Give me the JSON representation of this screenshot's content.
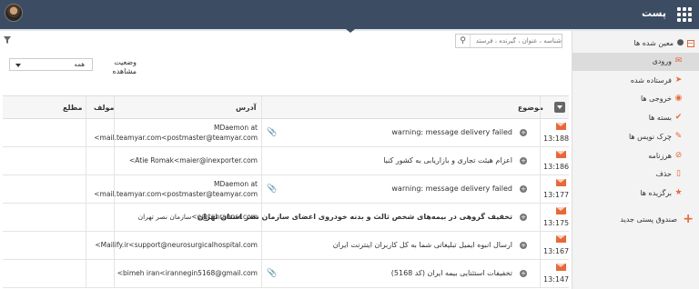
{
  "header": {
    "app_title": "پست"
  },
  "sidebar": {
    "root_label": "معین شده ها",
    "items": [
      {
        "label": "ورودی",
        "icon": "inbox-icon",
        "active": true
      },
      {
        "label": "فرستاده شده",
        "icon": "sent-icon"
      },
      {
        "label": "خروجی ها",
        "icon": "outbox-icon"
      },
      {
        "label": "بسته ها",
        "icon": "check-icon"
      },
      {
        "label": "چرک نویس ها",
        "icon": "draft-icon"
      },
      {
        "label": "هرزنامه",
        "icon": "spam-icon"
      },
      {
        "label": "حذف",
        "icon": "trash-icon"
      },
      {
        "label": "برگزیده ها",
        "icon": "favorites-icon"
      }
    ],
    "new_folder_label": "صندوق پستی جدید"
  },
  "toolbar": {
    "search_placeholder": "شناسه ، عنوان ، گیرنده ، فرستد",
    "status_label": "وضعیت مشاهده",
    "status_value": "همه"
  },
  "table": {
    "columns": {
      "subject": "موضوع",
      "address": "آدرس",
      "author": "مولف",
      "related": "مطلع"
    },
    "rows": [
      {
        "id": "13:188",
        "subject": "warning: message delivery failed",
        "attachment": true,
        "addr1": "MDaemon at",
        "addr2": "<mail.teamyar.com<postmaster@teamyar.com",
        "bold": false
      },
      {
        "id": "13:186",
        "subject": "اعزام هیئت تجاری و بازاریابی به کشور کنیا",
        "attachment": false,
        "addr1": "",
        "addr2": "<Atie Romak<maier@inexporter.com",
        "bold": false
      },
      {
        "id": "13:177",
        "subject": "warning: message delivery failed",
        "attachment": true,
        "addr1": "MDaemon at",
        "addr2": "<mail.teamyar.com<postmaster@teamyar.com",
        "bold": false
      },
      {
        "id": "13:175",
        "subject": "تخفیف گروهی در بیمه‌های شخص ثالث و بدنه خودروی اعضای سازمان نصر استان تهران",
        "attachment": false,
        "addr1": "",
        "addr2": "سازمان نصر تهران<e@tehrannsr.com",
        "bold": true
      },
      {
        "id": "13:167",
        "subject": "ارسال انبوه ایمیل تبلیغاتی شما به کل کاربران اینترنت ایران",
        "attachment": false,
        "addr1": "",
        "addr2": "<Mailify.ir<support@neurosurgicalhospital.com",
        "bold": false
      },
      {
        "id": "13:147",
        "subject": "تخفیفات استثنایی بیمه ایران (کد 5168)",
        "attachment": true,
        "addr1": "",
        "addr2": "<bimeh iran<irannegin5168@gmail.com",
        "bold": false
      }
    ]
  }
}
